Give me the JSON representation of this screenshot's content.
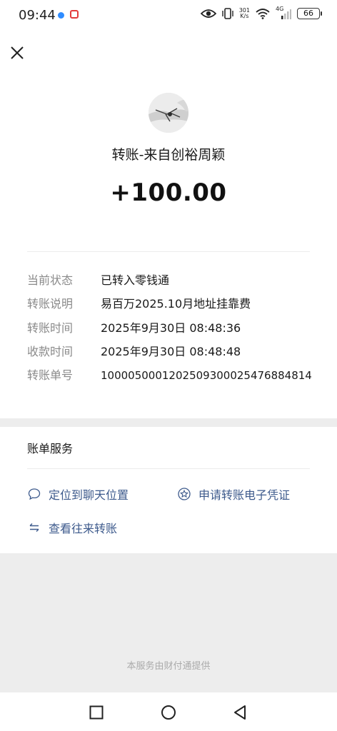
{
  "status_bar": {
    "time": "09:44",
    "net_speed_value": "301",
    "net_speed_unit": "K/s",
    "network_type": "4G",
    "battery": "66"
  },
  "transfer": {
    "title": "转账-来自创裕周颖",
    "amount": "+100.00"
  },
  "details": [
    {
      "label": "当前状态",
      "value": "已转入零钱通"
    },
    {
      "label": "转账说明",
      "value": "易百万2025.10月地址挂靠费"
    },
    {
      "label": "转账时间",
      "value": "2025年9月30日 08:48:36"
    },
    {
      "label": "收款时间",
      "value": "2025年9月30日 08:48:48"
    },
    {
      "label": "转账单号",
      "value": "1000050001202509300025476884814"
    }
  ],
  "services": {
    "title": "账单服务",
    "items": [
      {
        "label": "定位到聊天位置",
        "icon": "chat-bubble-icon"
      },
      {
        "label": "申请转账电子凭证",
        "icon": "badge-star-icon"
      },
      {
        "label": "查看往来转账",
        "icon": "exchange-arrows-icon"
      }
    ]
  },
  "footer": {
    "text": "本服务由财付通提供"
  },
  "colors": {
    "link": "#3d5a8c",
    "label_gray": "#8a8a8a",
    "page_bg": "#ededed"
  }
}
